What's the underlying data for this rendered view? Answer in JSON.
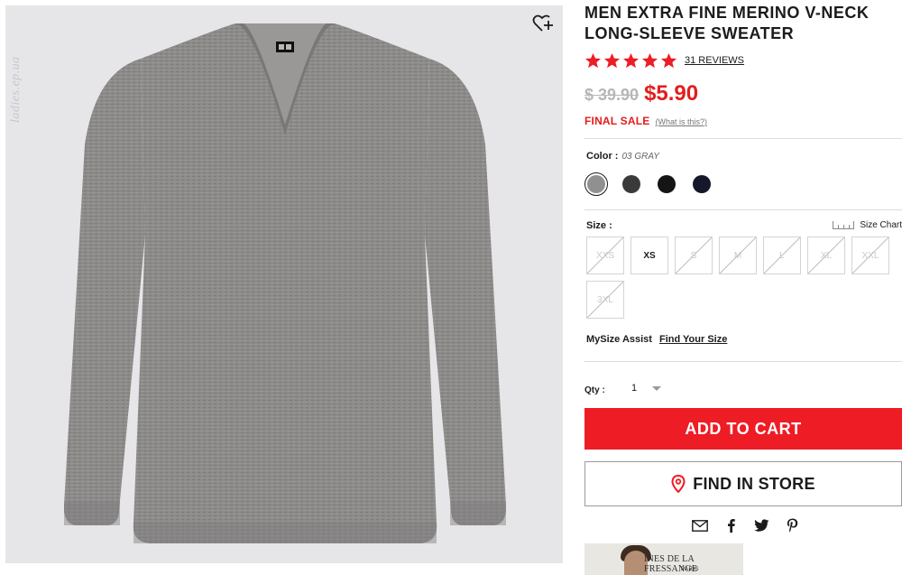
{
  "product": {
    "title": "MEN EXTRA FINE MERINO V-NECK LONG-SLEEVE SWEATER",
    "rating": 5,
    "reviews_label": "31 REVIEWS",
    "price_old": "$ 39.90",
    "price_new": "$5.90",
    "final_sale_label": "FINAL SALE",
    "what_is_this": "(What is this?)",
    "watermark": "ladies.ep.ua"
  },
  "color": {
    "label": "Color :",
    "value": "03 GRAY",
    "swatches": [
      {
        "name": "03 GRAY",
        "hex": "#909090",
        "selected": true
      },
      {
        "name": "Dark gray",
        "hex": "#3a3a3a",
        "selected": false
      },
      {
        "name": "Black",
        "hex": "#151515",
        "selected": false
      },
      {
        "name": "Navy",
        "hex": "#15182a",
        "selected": false
      }
    ]
  },
  "size": {
    "label": "Size :",
    "chart_label": "Size Chart",
    "options": [
      {
        "label": "XXS",
        "available": false
      },
      {
        "label": "XS",
        "available": true
      },
      {
        "label": "S",
        "available": false
      },
      {
        "label": "M",
        "available": false
      },
      {
        "label": "L",
        "available": false
      },
      {
        "label": "XL",
        "available": false
      },
      {
        "label": "XXL",
        "available": false
      },
      {
        "label": "3XL",
        "available": false
      }
    ]
  },
  "mysize": {
    "label": "MySize Assist",
    "link": "Find Your Size"
  },
  "qty": {
    "label": "Qty :",
    "value": "1"
  },
  "actions": {
    "add_to_cart": "ADD TO CART",
    "find_in_store": "FIND IN STORE"
  },
  "share": [
    "email-icon",
    "facebook-icon",
    "twitter-icon",
    "pinterest-icon"
  ],
  "promo": {
    "title": "INES DE LA FRESSANGE",
    "subtitle": "PARIS"
  },
  "colors": {
    "accent_red": "#ee1c25",
    "price_red": "#e31d1d",
    "sweater": "#8c8a89",
    "image_bg": "#e6e6e8"
  }
}
